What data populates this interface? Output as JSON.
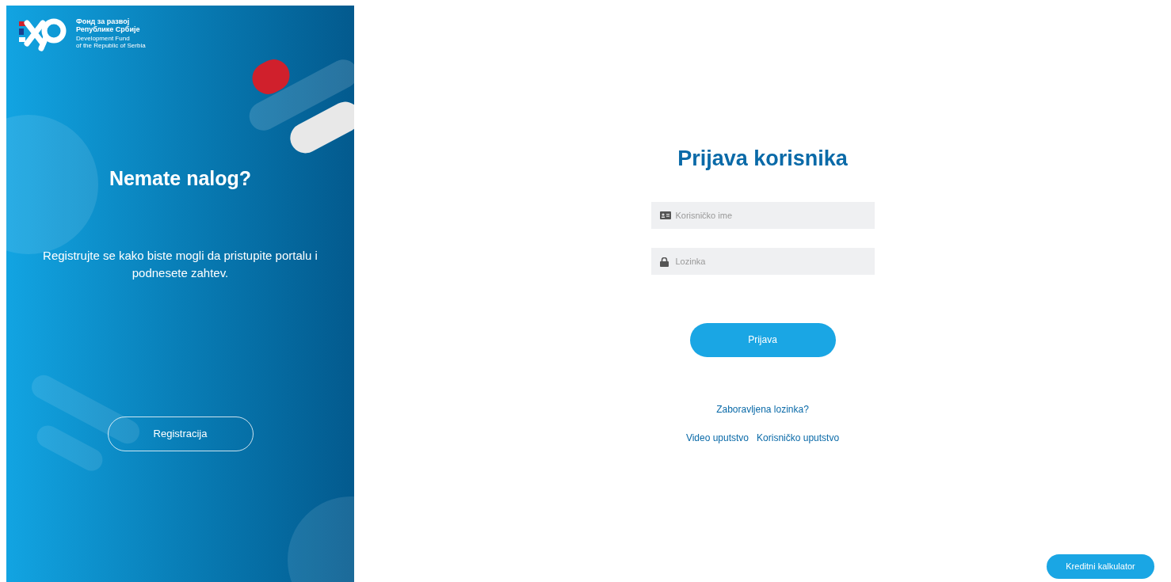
{
  "brand": {
    "name_line_1": "Фонд за развој",
    "name_line_2": "Републике Србије",
    "english_line_1": "Development Fund",
    "english_line_2": "of the Republic of Serbia"
  },
  "promo": {
    "title": "Nemate nalog?",
    "text": "Registrujte se kako biste mogli da pristupite portalu i podnesete zahtev.",
    "button": "Registracija"
  },
  "login": {
    "title": "Prijava korisnika",
    "fields": [
      {
        "kind": "user",
        "placeholder": "Korisničko ime"
      },
      {
        "kind": "password",
        "placeholder": "Lozinka"
      }
    ],
    "button": "Prijava",
    "forgot_link": "Zaboravljena lozinka?",
    "links": [
      "Video uputstvo",
      "Korisničko uputstvo"
    ]
  },
  "calculator_button": "Kreditni kalkulator"
}
